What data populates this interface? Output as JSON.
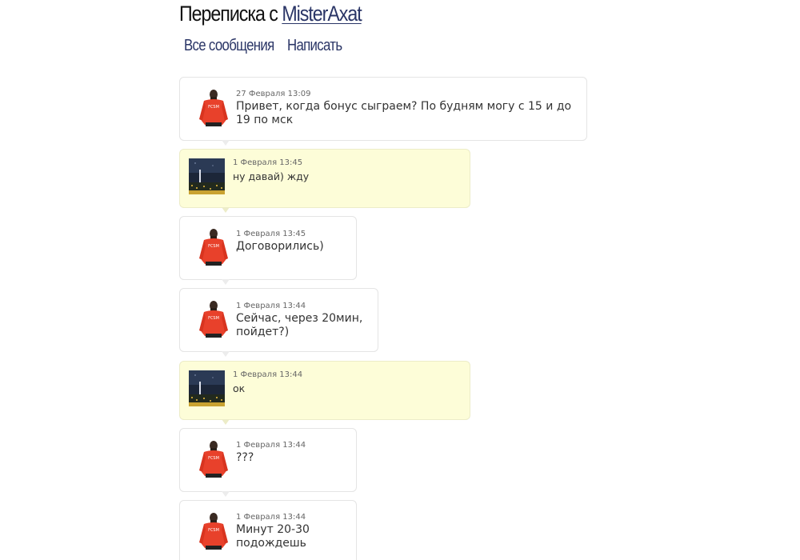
{
  "header": {
    "title_prefix": "Переписка с",
    "username": "MisterAxat"
  },
  "nav": {
    "all_messages": "Все сообщения",
    "write": "Написать"
  },
  "messages": [
    {
      "date": "27 Февраля 13:09",
      "text": "Привет, когда бонус сыграем? По будням могу с 15 и до 19 по мск",
      "author": "other"
    },
    {
      "date": "1 Февраля 13:45",
      "text": "ну давай) жду",
      "author": "me"
    },
    {
      "date": "1 Февраля 13:45",
      "text": "Договорились)",
      "author": "other"
    },
    {
      "date": "1 Февраля 13:44",
      "text": "Сейчас, через 20мин, пойдет?)",
      "author": "other"
    },
    {
      "date": "1 Февраля 13:44",
      "text": "ок",
      "author": "me"
    },
    {
      "date": "1 Февраля 13:44",
      "text": "???",
      "author": "other"
    },
    {
      "date": "1 Февраля 13:44",
      "text": "Минут 20-30 подождешь",
      "author": "other"
    }
  ],
  "avatar_labels": {
    "jacket": "FCSM"
  },
  "colors": {
    "link": "#2a3566",
    "my_message_bg": "#fdfdd8",
    "jacket_red": "#e8412b"
  }
}
